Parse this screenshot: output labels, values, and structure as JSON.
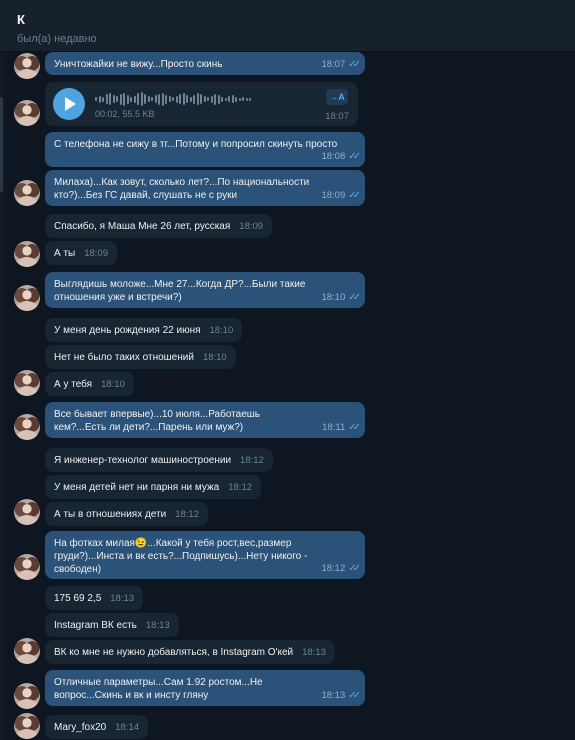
{
  "header": {
    "name": "К",
    "status": "был(а) недавно"
  },
  "voice": {
    "meta": "00:02, 55.5 KB",
    "time": "18:07",
    "transcribe_label": "→A"
  },
  "messages": [
    {
      "text": "Уничтожайки не вижу...Просто скинь",
      "time": "18:07"
    },
    {
      "text": "С телефона не сижу в тг...Потому и попросил скинуть просто",
      "time": "18:08"
    },
    {
      "text": "Милаха)...Как зовут, сколько лет?...По национальности кто?)...Без ГС давай, слушать не с руки",
      "time": "18:09"
    },
    {
      "text": "Спасибо, я Маша Мне 26 лет, русская",
      "time": "18:09"
    },
    {
      "text": "А ты",
      "time": "18:09"
    },
    {
      "text": "Выглядишь моложе...Мне 27...Когда ДР?...Были такие отношения уже и встречи?)",
      "time": "18:10"
    },
    {
      "text": "У меня день рождения 22 июня",
      "time": "18:10"
    },
    {
      "text": "Нет не было таких отношений",
      "time": "18:10"
    },
    {
      "text": "А у тебя",
      "time": "18:10"
    },
    {
      "text": "Все бывает впервые)...10 июля...Работаешь кем?...Есть ли дети?...Парень или муж?)",
      "time": "18:11"
    },
    {
      "text": "Я инженер-технолог машиностроении",
      "time": "18:12"
    },
    {
      "text": "У меня детей нет ни парня ни мужа",
      "time": "18:12"
    },
    {
      "text": "А ты в отношениях  дети",
      "time": "18:12"
    },
    {
      "text": "На фотках милая😉...Какой у тебя рост,вес,размер груди?)...Инста и вк есть?...Подпишусь)...Нету никого - свободен)",
      "time": "18:12"
    },
    {
      "text": "175 69 2,5",
      "time": "18:13"
    },
    {
      "text": "Instagram ВК есть",
      "time": "18:13"
    },
    {
      "text": "ВК ко мне не нужно добавляться, в Instagram О'кей",
      "time": "18:13"
    },
    {
      "text": "Отличные параметры...Сам 1.92 ростом...Не вопрос...Скинь и вк и инсту гляну",
      "time": "18:13"
    },
    {
      "text": "Mary_fox20",
      "time": "18:14"
    }
  ],
  "colors": {
    "background": "#0e1621",
    "incoming": "#182533",
    "outgoing": "#2b5278",
    "accent": "#4fa4e0",
    "read_check": "#5fa7e6"
  }
}
